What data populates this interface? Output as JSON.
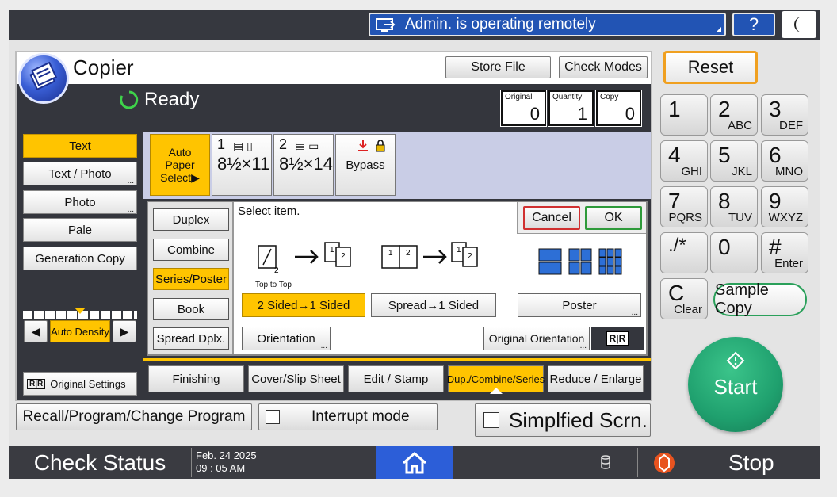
{
  "header": {
    "remote_text": "Admin. is operating remotely",
    "help_label": "?"
  },
  "app": {
    "title": "Copier",
    "status": "Ready",
    "store_file": "Store File",
    "check_modes": "Check Modes",
    "counters": [
      {
        "label": "Original",
        "value": "0"
      },
      {
        "label": "Quantity",
        "value": "1"
      },
      {
        "label": "Copy",
        "value": "0"
      }
    ]
  },
  "modes": [
    {
      "label": "Text",
      "selected": true,
      "dots": false
    },
    {
      "label": "Text / Photo",
      "selected": false,
      "dots": true
    },
    {
      "label": "Photo",
      "selected": false,
      "dots": true
    },
    {
      "label": "Pale",
      "selected": false,
      "dots": false
    },
    {
      "label": "Generation Copy",
      "selected": false,
      "dots": false
    }
  ],
  "density": {
    "label": "Auto Density"
  },
  "original_settings": "Original Settings",
  "paper": {
    "auto": "Auto Paper Select▶",
    "tray1_num": "1",
    "tray1_size": "8½×11",
    "tray2_num": "2",
    "tray2_size": "8½×14",
    "bypass": "Bypass"
  },
  "dialog": {
    "prompt": "Select item.",
    "cancel": "Cancel",
    "ok": "OK",
    "top_to_top": "Top to Top",
    "side_buttons": [
      "Duplex",
      "Combine",
      "Series/Poster",
      "Book",
      "Spread Dplx."
    ],
    "two_sided": "2 Sided→1 Sided",
    "spread": "Spread→1 Sided",
    "poster": "Poster",
    "orientation": "Orientation",
    "original_orientation": "Original Orientation"
  },
  "tabs": [
    "Finishing",
    "Cover/Slip Sheet",
    "Edit / Stamp",
    "Dup./Combine/Series",
    "Reduce / Enlarge"
  ],
  "bottom": {
    "recall": "Recall/Program/Change Program",
    "interrupt": "Interrupt mode",
    "simplified": "Simplfied Scrn."
  },
  "keypad": {
    "reset": "Reset",
    "keys": [
      {
        "d": "1",
        "s": ""
      },
      {
        "d": "2",
        "s": "ABC"
      },
      {
        "d": "3",
        "s": "DEF"
      },
      {
        "d": "4",
        "s": "GHI"
      },
      {
        "d": "5",
        "s": "JKL"
      },
      {
        "d": "6",
        "s": "MNO"
      },
      {
        "d": "7",
        "s": "PQRS"
      },
      {
        "d": "8",
        "s": "TUV"
      },
      {
        "d": "9",
        "s": "WXYZ"
      },
      {
        "d": "./*",
        "s": ""
      },
      {
        "d": "0",
        "s": ""
      },
      {
        "d": "#",
        "s": "Enter"
      }
    ],
    "clear_d": "C",
    "clear_s": "Clear",
    "sample_copy": "Sample Copy",
    "start": "Start"
  },
  "statusbar": {
    "check_status": "Check Status",
    "date": "Feb. 24 2025",
    "time": "09 : 05 AM",
    "stop": "Stop"
  },
  "colors": {
    "accent": "#ffc400",
    "blue": "#2254b4",
    "start": "#1fa06e"
  }
}
